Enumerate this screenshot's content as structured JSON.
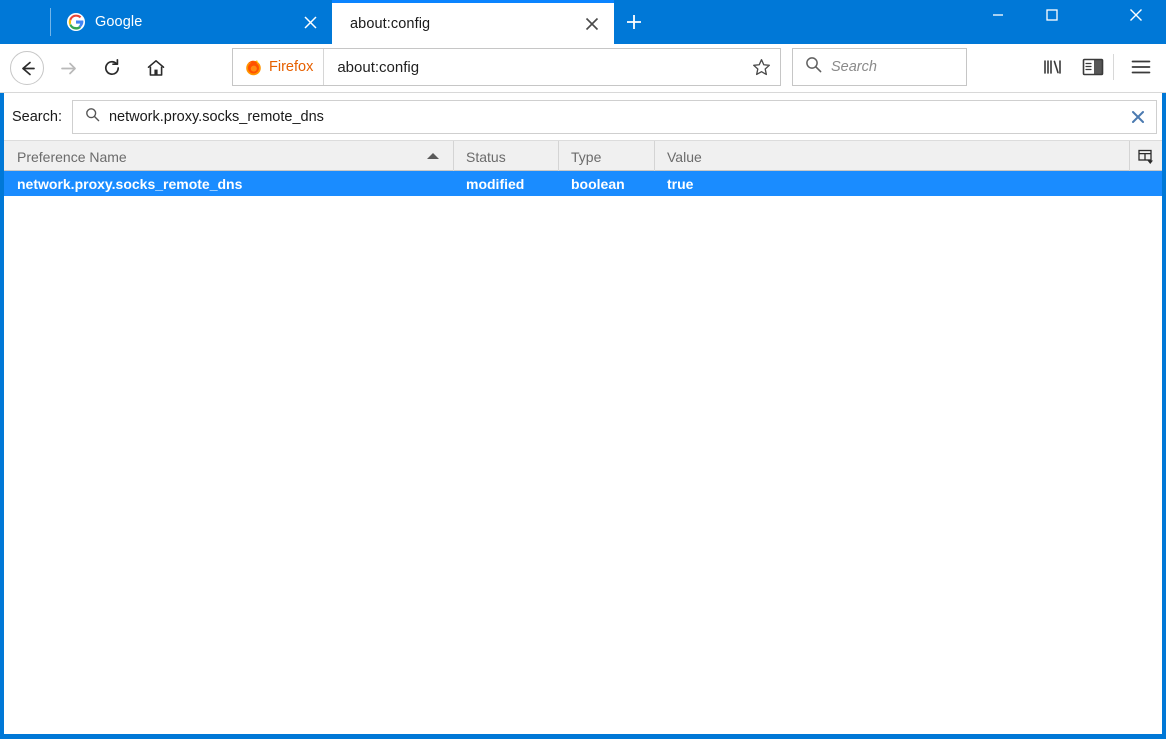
{
  "window": {
    "chrome_blue": "#0078d7",
    "controls": {
      "minimize": "minimize-button",
      "maximize": "maximize-button",
      "close": "close-button"
    }
  },
  "tabs": [
    {
      "title": "Google",
      "favicon": "google-favicon",
      "active": false,
      "close_label": "×"
    },
    {
      "title": "about:config",
      "favicon": "none",
      "active": true,
      "close_label": "×"
    }
  ],
  "new_tab_label": "+",
  "toolbar": {
    "back_label": "back-button",
    "forward_label": "forward-button",
    "reload_label": "reload-button",
    "home_label": "home-button",
    "identity_label": "Firefox",
    "identity_color": "#e66000",
    "url_value": "about:config",
    "bookmark_label": "bookmark-star",
    "search_placeholder": "Search",
    "library_label": "library-button",
    "sidebar_label": "sidebar-button",
    "menu_label": "menu-button"
  },
  "config_page": {
    "search_label": "Search:",
    "search_value": "network.proxy.socks_remote_dns",
    "search_clear_label": "×",
    "columns": [
      {
        "key": "name",
        "label": "Preference Name",
        "sorted": "asc"
      },
      {
        "key": "status",
        "label": "Status"
      },
      {
        "key": "type",
        "label": "Type"
      },
      {
        "key": "value",
        "label": "Value"
      }
    ],
    "column_picker_label": "column-picker",
    "rows": [
      {
        "name": "network.proxy.socks_remote_dns",
        "status": "modified",
        "type": "boolean",
        "value": "true",
        "selected": true
      }
    ],
    "selection_color": "#1a8cff"
  }
}
